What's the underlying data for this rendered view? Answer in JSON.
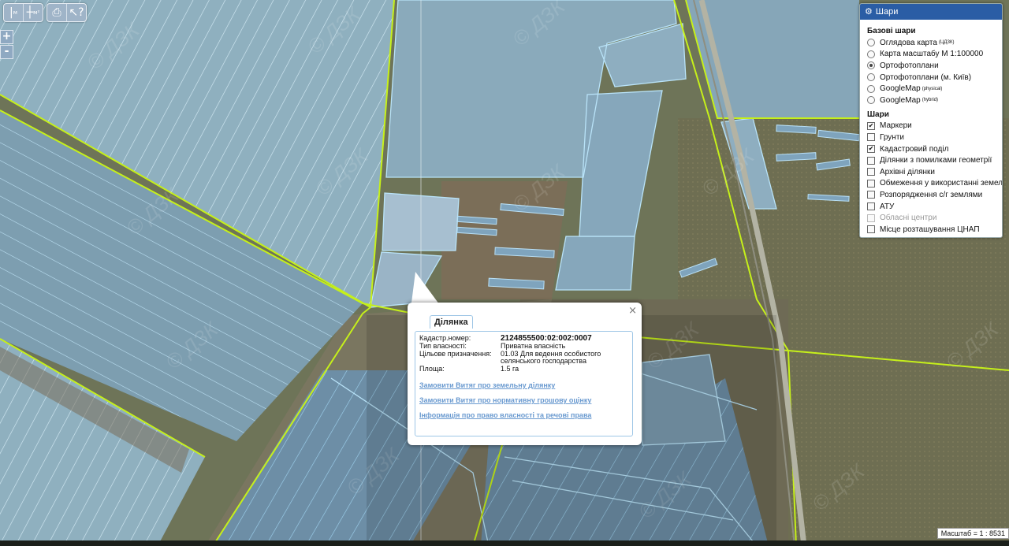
{
  "toolbar": {
    "measure_m": "м",
    "measure_m2": "м²"
  },
  "zoom": {
    "in": "+",
    "out": "-"
  },
  "layers_panel": {
    "title": "Шари",
    "base_title": "Базові шари",
    "base_layers": [
      {
        "label": "Оглядова карта",
        "sup": "(ЦДЗК)",
        "selected": false
      },
      {
        "label": "Карта масштабу М 1:100000",
        "sup": "",
        "selected": false
      },
      {
        "label": "Ортофотоплани",
        "sup": "",
        "selected": true
      },
      {
        "label": "Ортофотоплани (м. Київ)",
        "sup": "",
        "selected": false
      },
      {
        "label": "GoogleMap",
        "sup": "(physical)",
        "selected": false
      },
      {
        "label": "GoogleMap",
        "sup": "(hybrid)",
        "selected": false
      }
    ],
    "layers_title": "Шари",
    "layers": [
      {
        "label": "Маркери",
        "checked": true,
        "disabled": false
      },
      {
        "label": "Грунти",
        "checked": false,
        "disabled": false
      },
      {
        "label": "Кадастровий поділ",
        "checked": true,
        "disabled": false
      },
      {
        "label": "Ділянки з помилками геометрії",
        "checked": false,
        "disabled": false
      },
      {
        "label": "Архівні ділянки",
        "checked": false,
        "disabled": false
      },
      {
        "label": "Обмеження у використанні земель",
        "checked": false,
        "disabled": false
      },
      {
        "label": "Розпорядження с/г землями",
        "checked": false,
        "disabled": false
      },
      {
        "label": "АТУ",
        "checked": false,
        "disabled": false
      },
      {
        "label": "Обласні центри",
        "checked": false,
        "disabled": true
      },
      {
        "label": "Місце розташування ЦНАП",
        "checked": false,
        "disabled": false
      }
    ]
  },
  "popup": {
    "close": "×",
    "tab": "Ділянка",
    "rows": [
      {
        "label": "Кадастр.номер:",
        "value": "2124855500:02:002:0007"
      },
      {
        "label": "Тип власності:",
        "value": "Приватна власність"
      },
      {
        "label": "Цільове призначення:",
        "value": "01.03 Для ведення особистого селянського господарства"
      },
      {
        "label": "Площа:",
        "value": "1.5 га"
      }
    ],
    "links": [
      "Замовити Витяг про земельну ділянку",
      "Замовити Витяг про нормативну грошову оцінку",
      "Інформація про право власності та речові права"
    ]
  },
  "watermark": "© ДЗК",
  "scale_text": "Масштаб = 1 : 8531"
}
